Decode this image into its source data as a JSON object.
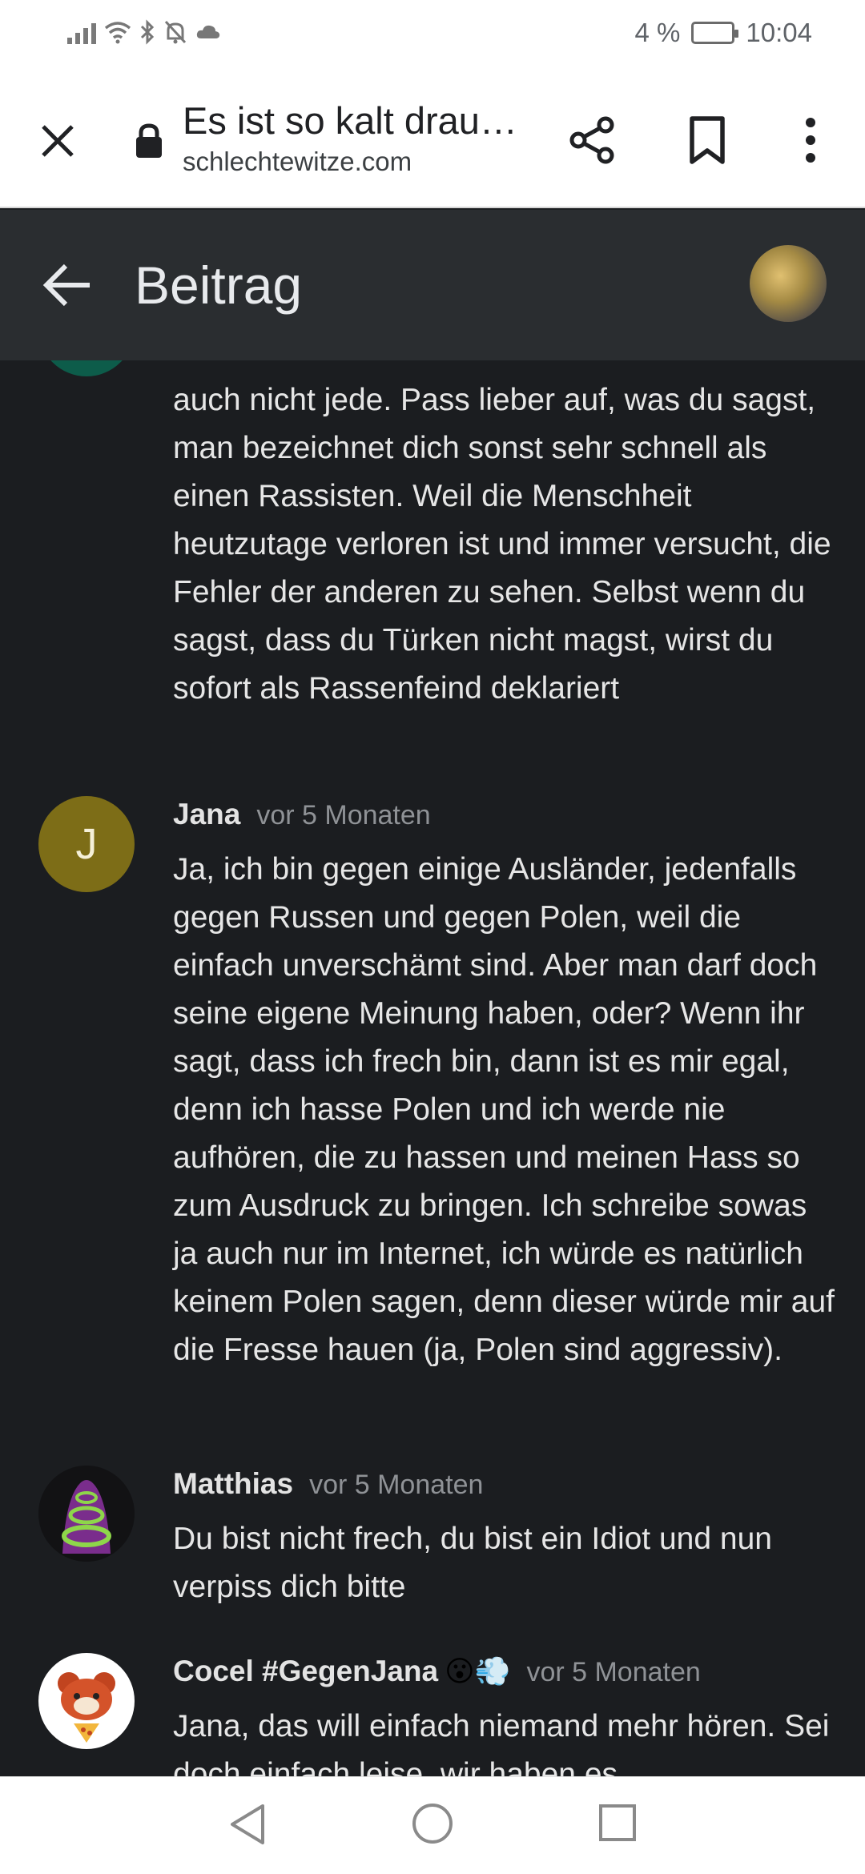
{
  "status": {
    "battery_percent": "4 %",
    "time": "10:04"
  },
  "browser": {
    "title": "Es ist so kalt drau…",
    "url": "schlechtewitze.com"
  },
  "header": {
    "title": "Beitrag"
  },
  "comments": [
    {
      "author": "",
      "time": "",
      "text": "auch nicht jede. Pass lieber auf, was du sagst, man bezeichnet dich sonst sehr schnell als einen Rassisten. Weil die Menschheit heutzutage verloren ist und immer versucht, die Fehler der anderen zu sehen. Selbst wenn du sagst, dass du Türken nicht magst, wirst du sofort als Rassenfeind deklariert"
    },
    {
      "author": "Jana",
      "time": "vor 5 Monaten",
      "initial": "J",
      "text": "Ja, ich bin gegen einige Ausländer, jedenfalls gegen Russen und gegen Polen, weil die einfach unverschämt sind. Aber man darf doch seine eigene Meinung haben, oder? Wenn ihr sagt, dass ich frech bin, dann ist es mir egal, denn ich hasse Polen und ich werde nie aufhören, die zu hassen und meinen Hass so zum Ausdruck zu bringen. Ich schreibe sowas ja auch nur im Internet, ich würde es natürlich keinem Polen sagen, denn dieser würde mir auf die Fresse hauen (ja, Polen sind aggressiv)."
    },
    {
      "author": "Matthias",
      "time": "vor 5 Monaten",
      "text": "Du bist nicht frech, du bist ein Idiot und nun verpiss dich bitte"
    },
    {
      "author": "Cocel #GegenJana",
      "emoji": "😮💨",
      "time": "vor 5 Monaten",
      "text": "Jana, das will einfach niemand mehr hören. Sei doch einfach leise, wir haben es"
    }
  ],
  "colors": {
    "jana_avatar": "#7d6d17",
    "first_avatar": "#0d5c4a",
    "matthias_avatar": "#7a2d8c"
  }
}
